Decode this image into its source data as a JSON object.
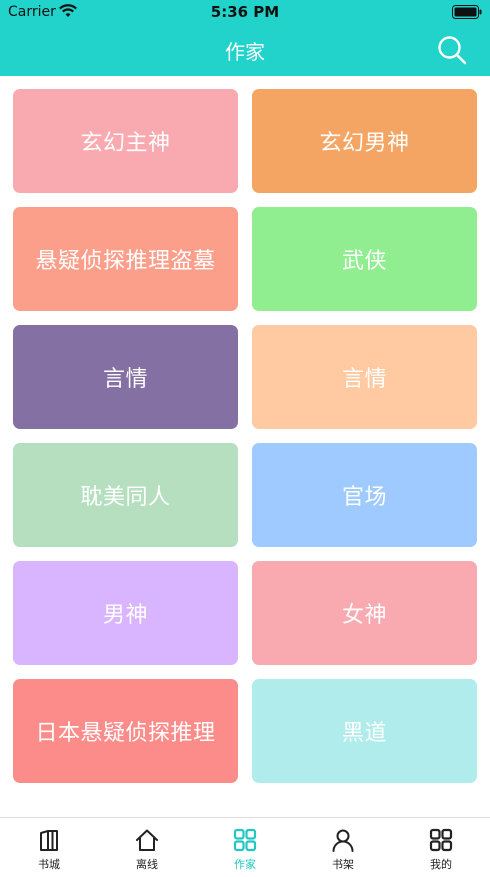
{
  "status_bar": {
    "carrier": "Carrier",
    "time": "5:36 PM"
  },
  "nav": {
    "title": "作家",
    "search_icon": "search-icon"
  },
  "colors": {
    "header": "#22d3cc",
    "active_tab": "#22c7c0"
  },
  "categories": [
    {
      "label": "玄幻主神",
      "color": "#f8aab0"
    },
    {
      "label": "玄幻男神",
      "color": "#f4a564"
    },
    {
      "label": "悬疑侦探推理盗墓",
      "color": "#fb9e8a"
    },
    {
      "label": "武侠",
      "color": "#90ee90"
    },
    {
      "label": "言情",
      "color": "#8470a2"
    },
    {
      "label": "言情",
      "color": "#ffc9a2"
    },
    {
      "label": "耽美同人",
      "color": "#b6dfc0"
    },
    {
      "label": "官场",
      "color": "#9ecaff"
    },
    {
      "label": "男神",
      "color": "#dab5ff"
    },
    {
      "label": "女神",
      "color": "#f8aab0"
    },
    {
      "label": "日本悬疑侦探推理",
      "color": "#fc8c89"
    },
    {
      "label": "黑道",
      "color": "#b0ecec"
    }
  ],
  "tabs": [
    {
      "label": "书城",
      "icon": "book-icon"
    },
    {
      "label": "离线",
      "icon": "home-icon"
    },
    {
      "label": "作家",
      "icon": "grid-icon",
      "active": true
    },
    {
      "label": "书架",
      "icon": "user-icon"
    },
    {
      "label": "我的",
      "icon": "grid-icon"
    }
  ]
}
